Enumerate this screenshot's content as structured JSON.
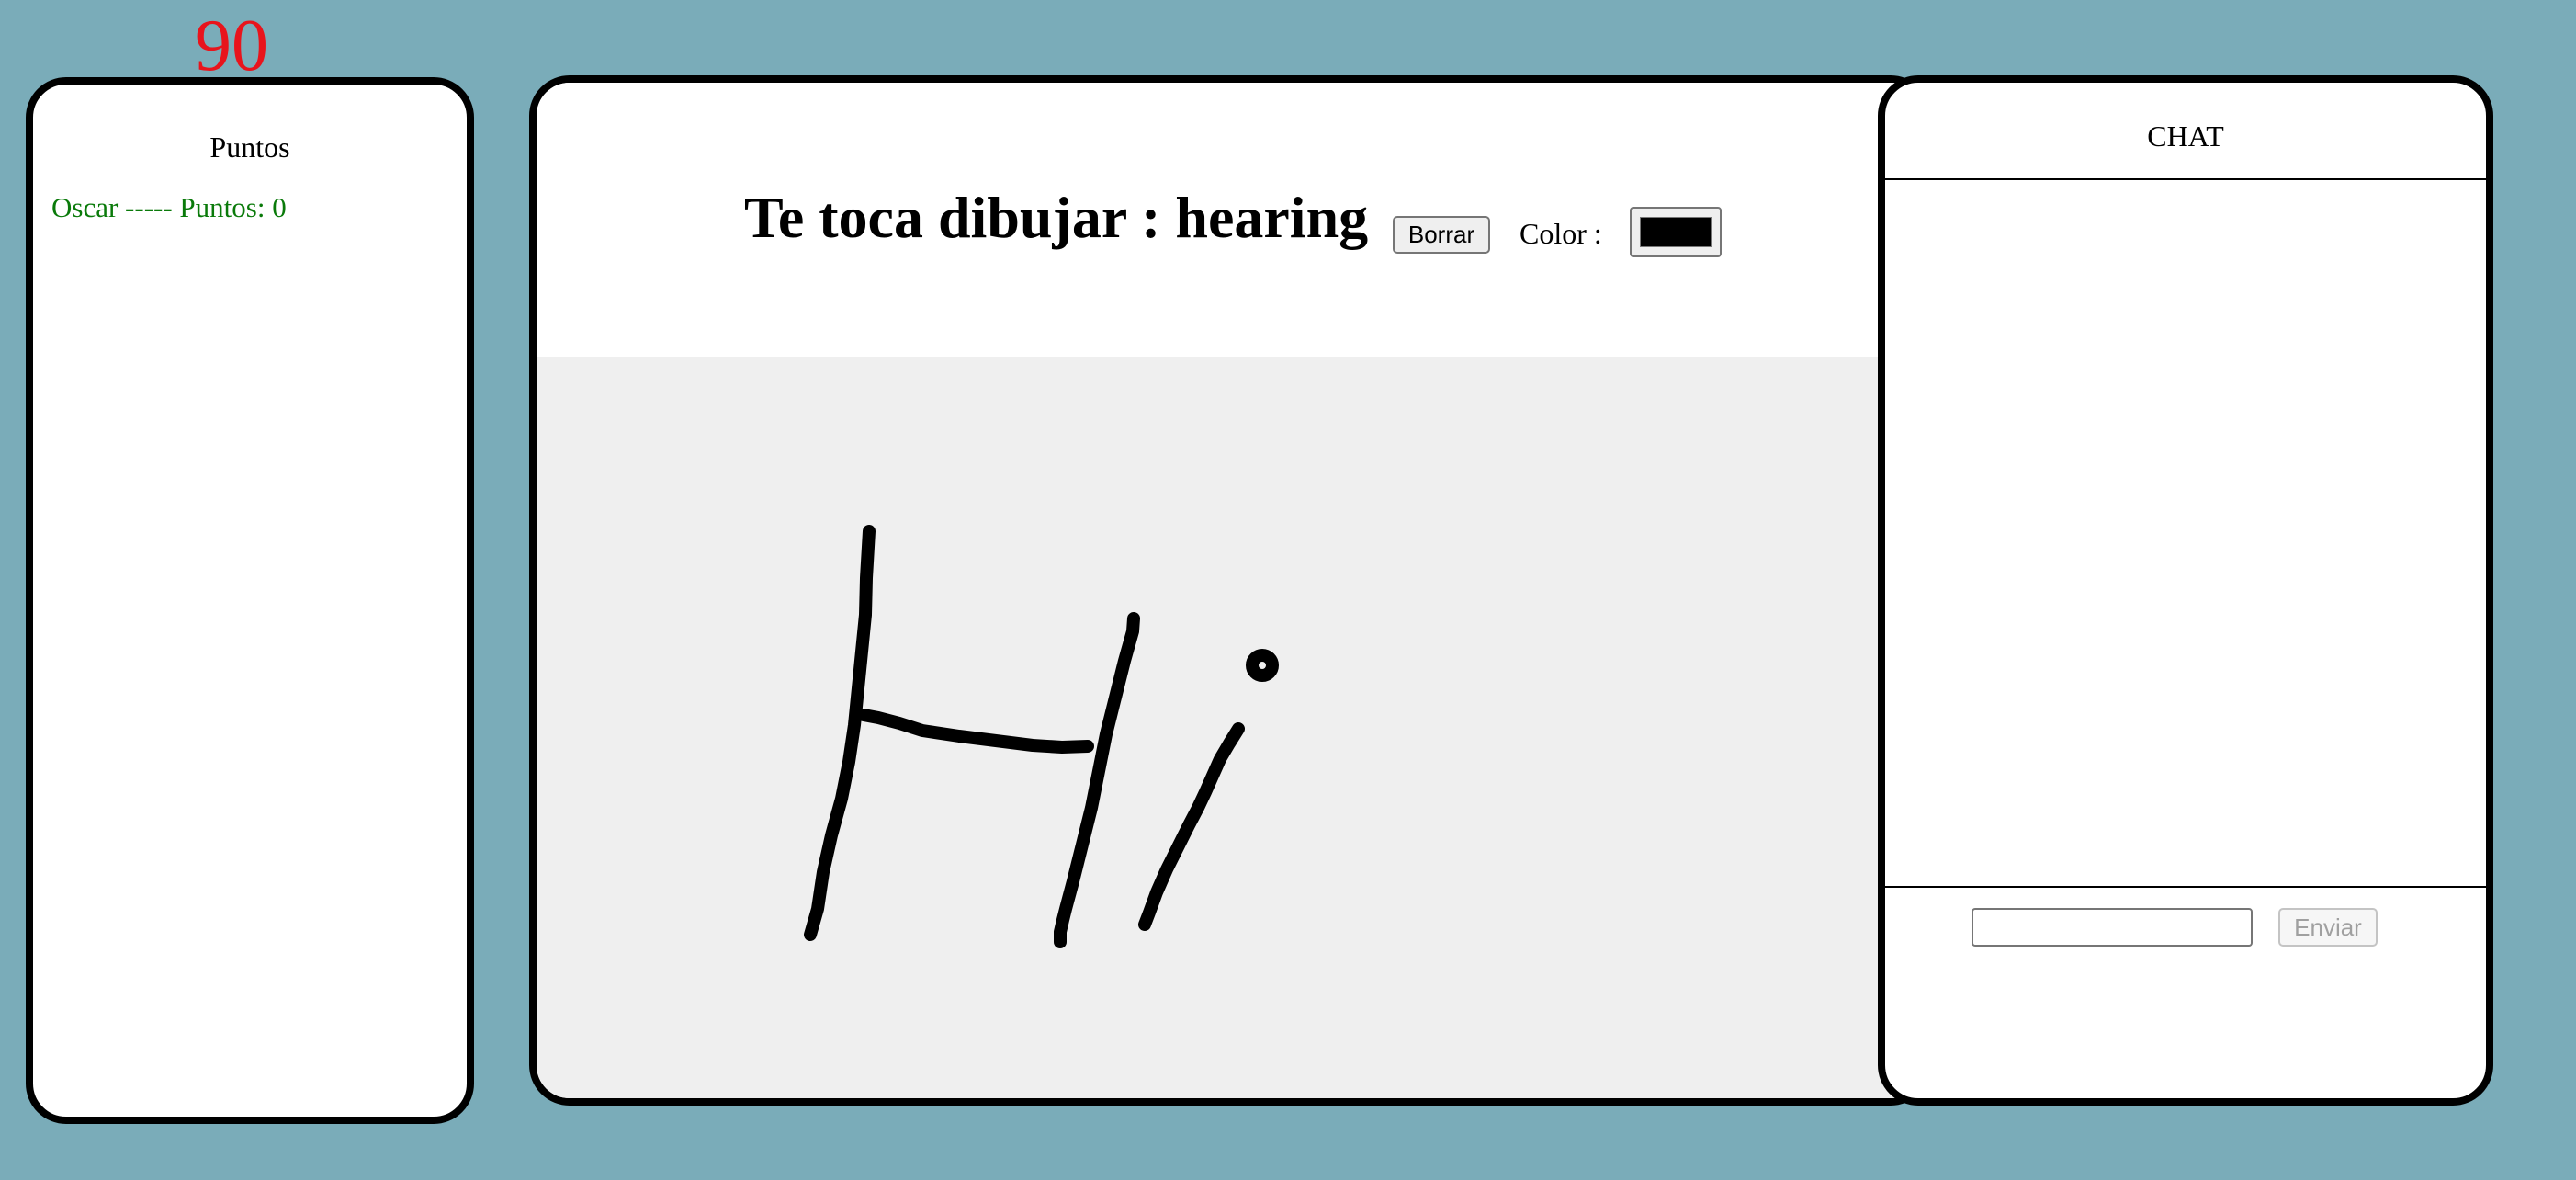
{
  "timer": {
    "value": "90"
  },
  "scores": {
    "title": "Puntos",
    "players": [
      {
        "text": "Oscar ----- Puntos: 0"
      }
    ]
  },
  "board": {
    "turn_label": "Te toca dibujar : hearing",
    "clear_label": "Borrar",
    "color_label": "Color :",
    "selected_color": "#000000",
    "canvas_background": "#efefef"
  },
  "chat": {
    "title": "CHAT",
    "messages": [],
    "input_value": "",
    "send_label": "Enviar"
  },
  "colors": {
    "page_background": "#7aacb9",
    "timer": "#e8141c",
    "score_text": "#0a7a0a"
  }
}
